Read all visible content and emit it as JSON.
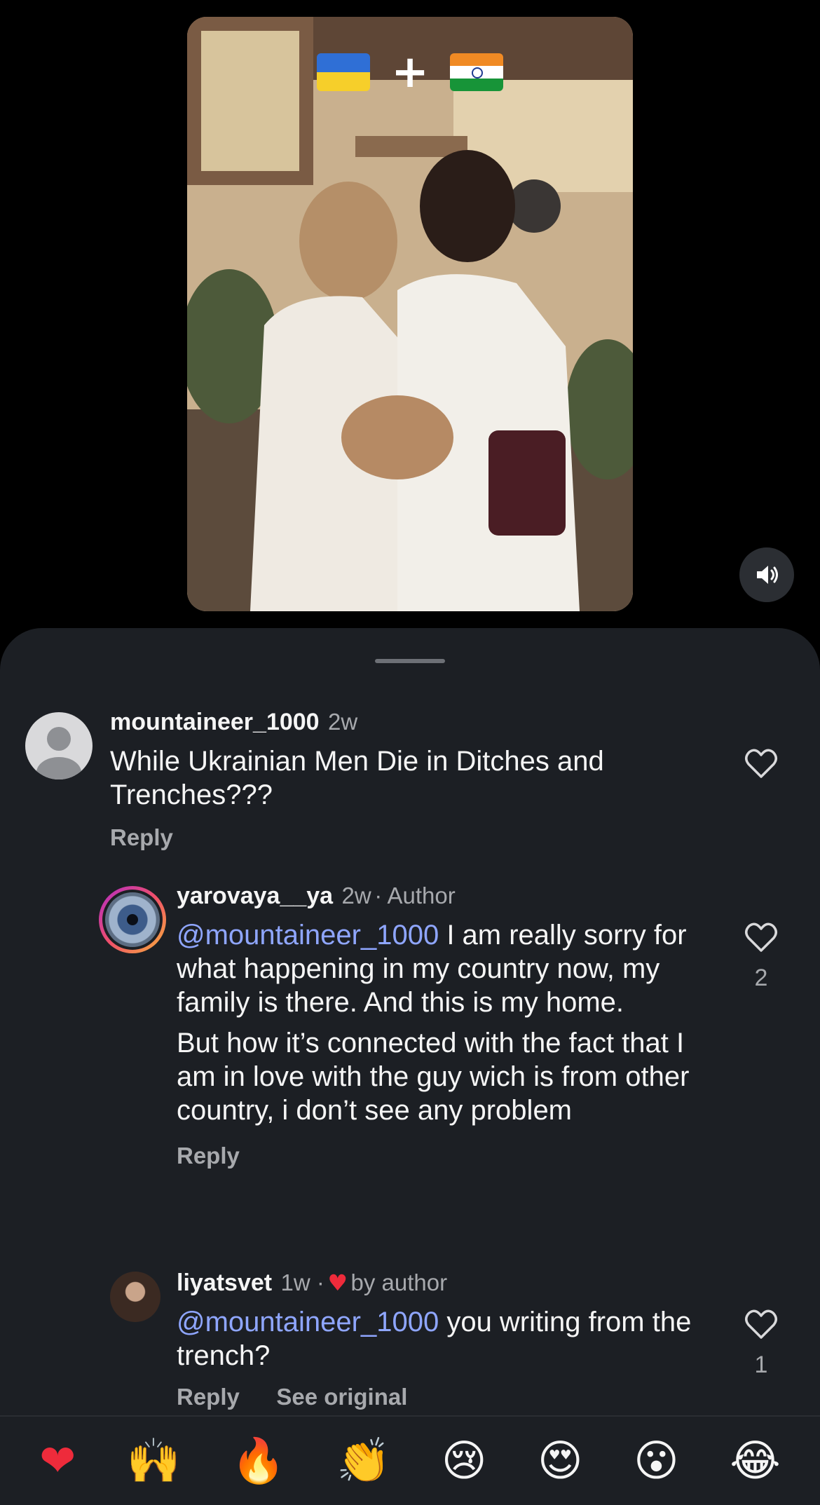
{
  "video": {
    "caption_plus": "+",
    "mute_icon": "speaker-muted-icon"
  },
  "comments": [
    {
      "username": "mountaineer_1000",
      "time": "2w",
      "text": "While Ukrainian Men Die in Ditches and Trenches???",
      "reply_label": "Reply"
    },
    {
      "username": "yarovaya__ya",
      "time": "2w",
      "author_badge": "· Author",
      "mention": "@mountaineer_1000",
      "text_part1": " I am really sorry for what happening in my country now, my family is there. And this is my home.",
      "text_part2": "But how it’s connected with the fact that I am in love with the guy wich is from other country, i don’t see any problem",
      "reply_label": "Reply",
      "likes": "2"
    },
    {
      "username": "liyatsvet",
      "time": "1w ·",
      "liked_by": "by author",
      "mention": "@mountaineer_1000",
      "text": " you writing from the trench?",
      "reply_label": "Reply",
      "see_original_label": "See original",
      "likes": "1"
    }
  ],
  "reactions": [
    "❤",
    "🙌",
    "🔥",
    "👏",
    "😢",
    "😍",
    "😮",
    "😂"
  ],
  "colors": {
    "sheet": "#1c1f24",
    "mention": "#8fa6ff",
    "heart_red": "#ee2b3b"
  }
}
